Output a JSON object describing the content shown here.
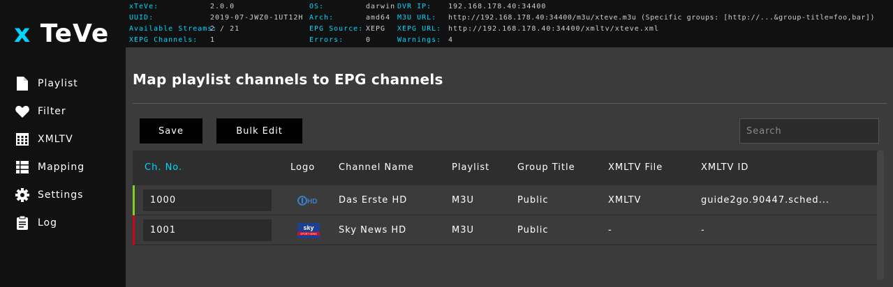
{
  "app": {
    "logo_x": "x",
    "logo_rest": "TeVe"
  },
  "info": {
    "col1": [
      {
        "key": "xTeVe:",
        "value": "2.0.0"
      },
      {
        "key": "UUID:",
        "value": "2019-07-JWZ0-1UT12H"
      },
      {
        "key": "Available Streams:",
        "value": "2 / 21"
      },
      {
        "key": "XEPG Channels:",
        "value": "1"
      }
    ],
    "col2": [
      {
        "key": "OS:",
        "value": "darwin"
      },
      {
        "key": "Arch:",
        "value": "amd64"
      },
      {
        "key": "EPG Source:",
        "value": "XEPG"
      },
      {
        "key": "Errors:",
        "value": "0"
      }
    ],
    "col3": [
      {
        "key": "DVR IP:",
        "value": "192.168.178.40:34400"
      },
      {
        "key": "M3U URL:",
        "value": "http://192.168.178.40:34400/m3u/xteve.m3u (Specific groups: [http://...&group-title=foo,bar])"
      },
      {
        "key": "XEPG URL:",
        "value": "http://192.168.178.40:34400/xmltv/xteve.xml"
      },
      {
        "key": "Warnings:",
        "value": "4"
      }
    ]
  },
  "sidebar": {
    "items": [
      {
        "label": "Playlist",
        "icon": "file-icon"
      },
      {
        "label": "Filter",
        "icon": "heart-icon"
      },
      {
        "label": "XMLTV",
        "icon": "calendar-grid-icon"
      },
      {
        "label": "Mapping",
        "icon": "list-icon"
      },
      {
        "label": "Settings",
        "icon": "gear-icon"
      },
      {
        "label": "Log",
        "icon": "clipboard-icon"
      }
    ]
  },
  "main": {
    "title": "Map playlist channels to EPG channels",
    "save_label": "Save",
    "bulk_edit_label": "Bulk Edit",
    "search_placeholder": "Search",
    "columns": [
      "Ch. No.",
      "Logo",
      "Channel Name",
      "Playlist",
      "Group Title",
      "XMLTV File",
      "XMLTV ID"
    ],
    "rows": [
      {
        "ch_no": "1000",
        "logo": "das-erste-hd-logo",
        "logo_text": "HD",
        "channel_name": "Das Erste HD",
        "playlist": "M3U",
        "group_title": "Public",
        "xmltv_file": "XMLTV",
        "xmltv_id": "guide2go.90447.sched...",
        "status_color": "#7ed321"
      },
      {
        "ch_no": "1001",
        "logo": "sky-news-hd-logo",
        "logo_text": "sky",
        "logo_subtext": "SPORT NEWS",
        "channel_name": "Sky News HD",
        "playlist": "M3U",
        "group_title": "Public",
        "xmltv_file": "-",
        "xmltv_id": "-",
        "status_color": "#d0021b"
      }
    ]
  },
  "colors": {
    "accent": "#00d6ff",
    "active_ok": "#7ed321",
    "inactive": "#d0021b"
  }
}
